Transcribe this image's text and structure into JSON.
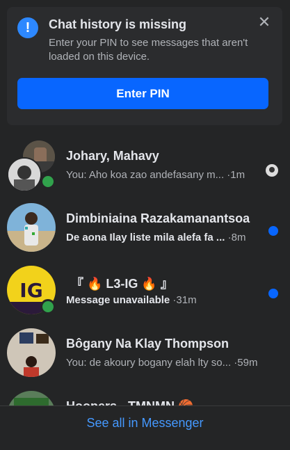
{
  "banner": {
    "icon": "info-icon",
    "title": "Chat history is missing",
    "description": "Enter your PIN to see messages that aren't loaded on this device.",
    "close_icon": "close-icon",
    "button_label": "Enter PIN"
  },
  "conversations": [
    {
      "name": "Johary, Mahavy",
      "snippet": "You: Aho koa zao andefasany m...",
      "time": "1m",
      "unread": false,
      "online": true,
      "seen": true
    },
    {
      "name": "Dimbiniaina Razakamanantsoa",
      "snippet": "De aona Ilay liste mila alefa fa ...",
      "time": "8m",
      "unread": true,
      "online": false,
      "seen": false
    },
    {
      "name": "『 🔥 L3-IG 🔥 』",
      "snippet": "Message unavailable",
      "time": "31m",
      "unread": true,
      "online": true,
      "seen": false
    },
    {
      "name": "Bôgany Na Klay Thompson",
      "snippet": "You: de akoury bogany elah lty so...",
      "time": "59m",
      "unread": false,
      "online": false,
      "seen": false
    },
    {
      "name": "Hoopers - TMNMN 🏀",
      "snippet": "",
      "time": "",
      "unread": false,
      "online": false,
      "seen": false
    }
  ],
  "footer": {
    "see_all_label": "See all in Messenger"
  },
  "colors": {
    "background": "#242526",
    "accent": "#0866ff",
    "link": "#4599ff",
    "online": "#31a24c"
  }
}
